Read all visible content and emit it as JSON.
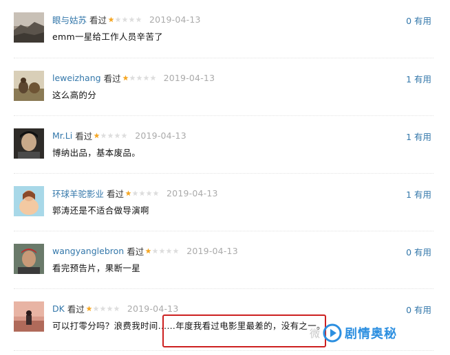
{
  "watched_label": "看过",
  "comments": [
    {
      "user": "眼与姑苏",
      "stars": 1,
      "max_stars": 5,
      "date": "2019-04-13",
      "votes": "0 有用",
      "text": "emm一星给工作人员辛苦了"
    },
    {
      "user": "leweizhang",
      "stars": 1,
      "max_stars": 5,
      "date": "2019-04-13",
      "votes": "1 有用",
      "text": "这么高的分"
    },
    {
      "user": "Mr.Li",
      "stars": 1,
      "max_stars": 5,
      "date": "2019-04-13",
      "votes": "1 有用",
      "text": "博纳出品，基本废品。"
    },
    {
      "user": "环球羊驼影业",
      "stars": 1,
      "max_stars": 5,
      "date": "2019-04-13",
      "votes": "1 有用",
      "text": "郭涛还是不适合做导演啊"
    },
    {
      "user": "wangyanglebron",
      "stars": 1,
      "max_stars": 5,
      "date": "2019-04-13",
      "votes": "0 有用",
      "text": "看完预告片，果断一星"
    },
    {
      "user": "DK",
      "stars": 1,
      "max_stars": 5,
      "date": "2019-04-13",
      "votes": "0 有用",
      "text": "可以打零分吗？浪费我时间……年度我看过电影里最差的，没有之一。"
    }
  ],
  "watermark": {
    "prefix": "微",
    "text": "剧情奥秘"
  },
  "colors": {
    "link": "#3377aa",
    "star_on": "#f5a623",
    "star_off": "#dddddd",
    "highlight": "#cc1f1f",
    "watermark": "#2c8fe0"
  }
}
